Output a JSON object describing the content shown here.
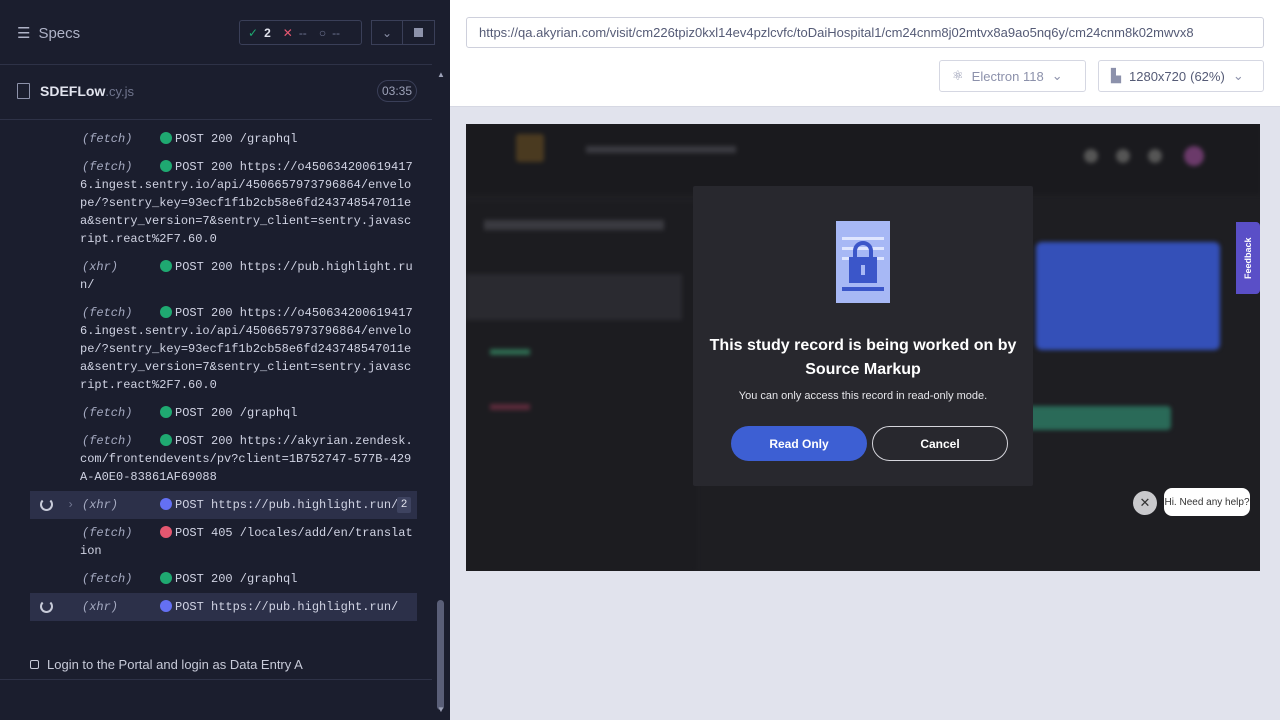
{
  "runner": {
    "specs_label": "Specs",
    "passed": "2",
    "failed": "--",
    "pending": "--",
    "spec_file": "SDEFLow",
    "spec_ext": ".cy.js",
    "duration": "03:35",
    "test_title": "Login to the Portal and login as Data Entry A",
    "log": [
      {
        "type": "(fetch)",
        "status": "green",
        "msg": "POST 200 /graphql"
      },
      {
        "type": "(fetch)",
        "status": "green",
        "msg": "POST 200 https://o4506342006194176.ingest.sentry.io/api/4506657973796864/envelope/?sentry_key=93ecf1f1b2cb58e6fd243748547011ea&sentry_version=7&sentry_client=sentry.javascript.react%2F7.60.0"
      },
      {
        "type": "(xhr)",
        "status": "green",
        "msg": "POST 200 https://pub.highlight.run/"
      },
      {
        "type": "(fetch)",
        "status": "green",
        "msg": "POST 200 https://o4506342006194176.ingest.sentry.io/api/4506657973796864/envelope/?sentry_key=93ecf1f1b2cb58e6fd243748547011ea&sentry_version=7&sentry_client=sentry.javascript.react%2F7.60.0"
      },
      {
        "type": "(fetch)",
        "status": "green",
        "msg": "POST 200 /graphql"
      },
      {
        "type": "(fetch)",
        "status": "green",
        "msg": "POST 200 https://akyrian.zendesk.com/frontendevents/pv?client=1B752747-577B-429A-A0E0-83861AF69088"
      },
      {
        "type": "(xhr)",
        "status": "blue",
        "msg": "POST https://pub.highlight.run/",
        "pending": true,
        "count": "2"
      },
      {
        "type": "(fetch)",
        "status": "red",
        "msg": "POST 405 /locales/add/en/translation"
      },
      {
        "type": "(fetch)",
        "status": "green",
        "msg": "POST 200 /graphql"
      },
      {
        "type": "(xhr)",
        "status": "blue",
        "msg": "POST https://pub.highlight.run/",
        "pending": true
      }
    ]
  },
  "browser": {
    "url": "https://qa.akyrian.com/visit/cm226tpiz0kxl14ev4pzlcvfc/toDaiHospital1/cm24cnm8j02mtvx8a9ao5nq6y/cm24cnm8k02mwvx8",
    "browser_label": "Electron 118",
    "viewport_label": "1280x720",
    "viewport_scale": "(62%)"
  },
  "modal": {
    "title": "This study record is being worked on by Source Markup",
    "subtitle": "You can only access this record in read-only mode.",
    "read_only_label": "Read Only",
    "cancel_label": "Cancel"
  },
  "help_chat": "Hi. Need any help?",
  "feedback_label": "Feedback",
  "colors": {
    "pass": "#1fa971",
    "fail": "#e45770",
    "pending": "#6470f3",
    "primary": "#3d5fd3"
  }
}
